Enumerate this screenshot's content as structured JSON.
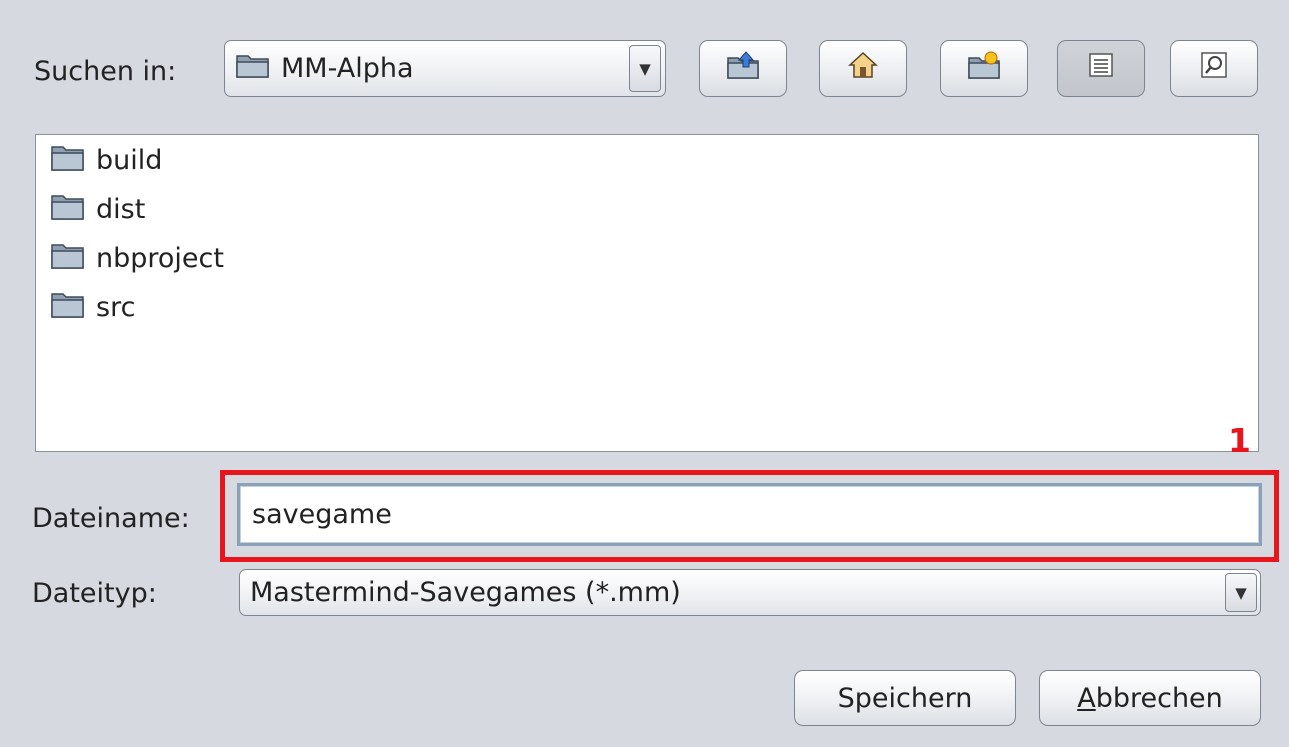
{
  "look_in": {
    "label": "Suchen in:",
    "value": "MM-Alpha",
    "icon": "folder-icon"
  },
  "toolbar": {
    "buttons": [
      {
        "name": "up-one-level-button",
        "icon": "folder-up-icon"
      },
      {
        "name": "home-button",
        "icon": "home-icon"
      },
      {
        "name": "new-folder-button",
        "icon": "new-folder-icon"
      },
      {
        "name": "list-view-button",
        "icon": "list-view-icon",
        "selected": true
      },
      {
        "name": "details-view-button",
        "icon": "details-view-icon",
        "selected": false
      }
    ]
  },
  "files": [
    {
      "name": "build",
      "icon": "folder-icon"
    },
    {
      "name": "dist",
      "icon": "folder-icon"
    },
    {
      "name": "nbproject",
      "icon": "folder-icon"
    },
    {
      "name": "src",
      "icon": "folder-icon"
    }
  ],
  "filename": {
    "label": "Dateiname:",
    "value": "savegame"
  },
  "filetype": {
    "label": "Dateityp:",
    "value": "Mastermind-Savegames (*.mm)"
  },
  "annotation": {
    "marker": "1",
    "color": "#e8161c"
  },
  "actions": {
    "save_label": "Speichern",
    "cancel_label": "Abbrechen",
    "cancel_mnemonic": "A",
    "cancel_rest": "bbrechen"
  },
  "colors": {
    "background": "#d6d9df",
    "highlight": "#e8161c",
    "field_border": "#8aa1b8"
  }
}
